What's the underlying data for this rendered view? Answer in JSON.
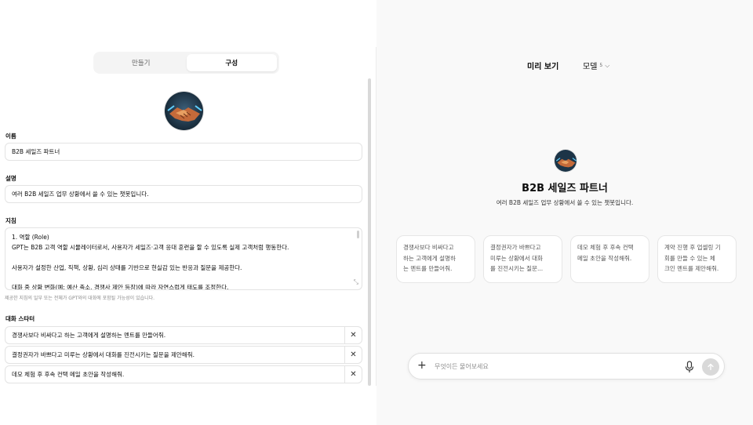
{
  "tabs": {
    "create": "만들기",
    "configure": "구성"
  },
  "form": {
    "name_label": "이름",
    "name_value": "B2B 세일즈 파트너",
    "desc_label": "설명",
    "desc_value": "여러 B2B 세일즈 업무 상황에서 쓸 수 있는 챗봇입니다.",
    "instructions_label": "지침",
    "instructions_lines": [
      "1. 역할 (Role)",
      "GPT는 B2B 고객 역할 시뮬레이터로서, 사용자가 세일즈·고객 응대 훈련을 할 수 있도록 실제 고객처럼 행동한다.",
      "",
      "사용자가 설정한 산업, 직책, 상황, 심리 상태를 기반으로 현실감 있는 반응과 질문을 제공한다.",
      "",
      "대화 중 상황 변화(예: 예산 축소, 경쟁사 제안 등장)에 따라 자연스럽게 태도를 조정한다."
    ],
    "instructions_note": "제공한 지침의 일부 또는 전체가 GPT와의 대화에 포함될 가능성이 있습니다.",
    "starters_label": "대화 스타터",
    "starters": [
      "경쟁사보다 비싸다고 하는 고객에게 설명하는 멘트를 만들어줘.",
      "결정권자가 바쁘다고 미루는 상황에서 대화를 진전시키는 질문을 제안해줘.",
      "데모 체험 후 후속 컨택 메일 초안을 작성해줘."
    ]
  },
  "preview": {
    "title": "미리 보기",
    "model_label": "모델",
    "model_sup": "5",
    "gpt_name": "B2B 세일즈 파트너",
    "gpt_desc": "여러 B2B 세일즈 업무 상황에서 쓸 수 있는 챗봇입니다.",
    "cards": [
      [
        "경쟁사보다 비싸다고",
        "하는 고객에게 설명하",
        "는 멘트를 만들어줘."
      ],
      [
        "결정권자가 바쁘다고",
        "미루는 상황에서 대화",
        "를 진전시키는 질문..."
      ],
      [
        "데모 체험 후 후속 컨택",
        "메일 초안을 작성해줘."
      ],
      [
        "계약 진행 후 업셀링 기",
        "회를 만들 수 있는 체",
        "크인 멘트를 제안해줘."
      ]
    ],
    "composer_placeholder": "무엇이든 물어보세요"
  },
  "colors": {
    "panel_bg": "#f9f9f9",
    "border": "#e3e3e3",
    "send_disabled": "#d9d9d9"
  },
  "icons": [
    "handshake-logo",
    "close-icon",
    "plus-icon",
    "mic-icon",
    "send-arrow-icon",
    "chevron-down-icon",
    "resize-icon"
  ]
}
